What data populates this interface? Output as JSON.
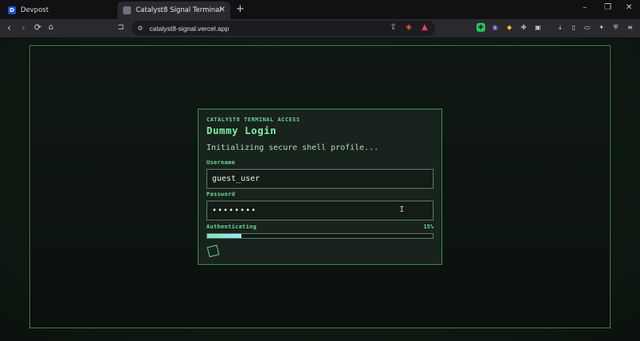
{
  "browser": {
    "tabs": [
      {
        "label": "Devpost",
        "favicon": "D",
        "active": false
      },
      {
        "label": "Catalyst8 Signal Terminal",
        "favicon": "",
        "active": true
      }
    ],
    "url": "catalyst8-signal.vercel.app",
    "window_controls": [
      "–",
      "❐",
      "✕"
    ],
    "new_tab": "+",
    "close_tab": "✕"
  },
  "login": {
    "kicker": "CATALYST8 TERMINAL ACCESS",
    "title": "Dummy Login",
    "status": "Initializing secure shell profile...",
    "username_label": "Username",
    "username_value": "guest_user",
    "password_label": "Password",
    "password_value": "••••••••",
    "auth_label": "Authenticating",
    "auth_percent": "15%",
    "progress": 0.15
  },
  "colors": {
    "accent": "#7cf0a6",
    "border": "#3c8a5a",
    "background": "#0f1a13"
  }
}
